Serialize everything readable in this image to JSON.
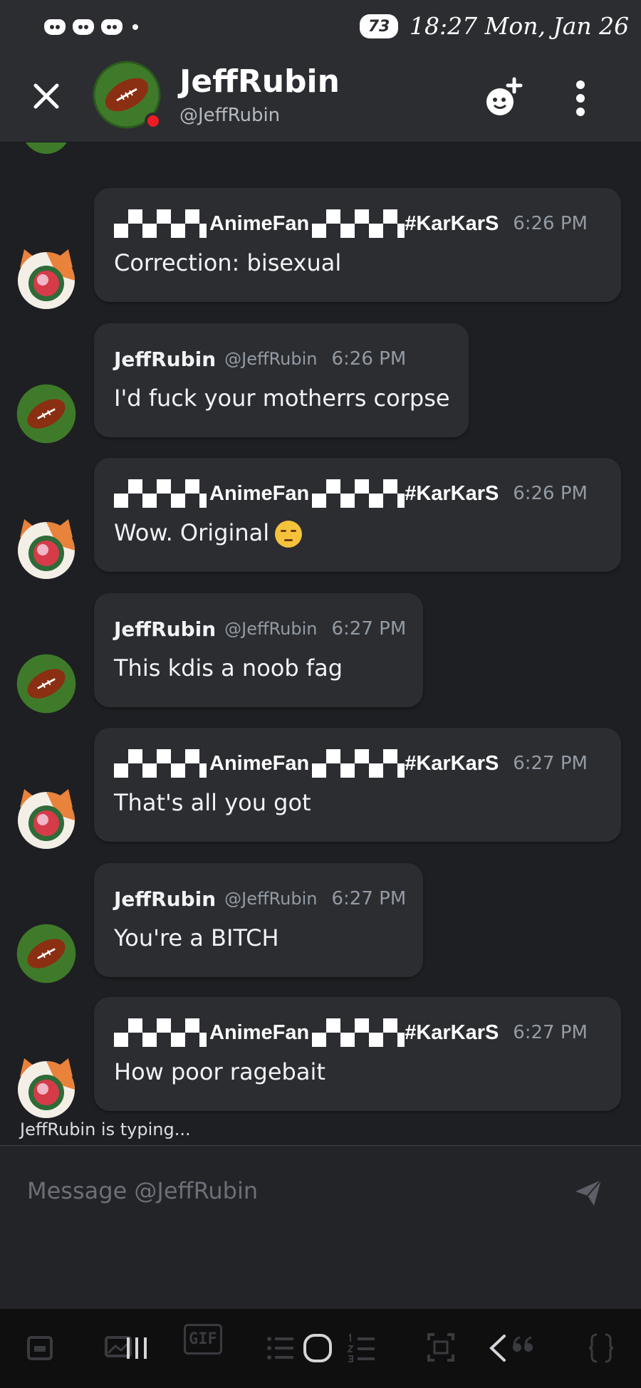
{
  "status_bar": {
    "battery": "73",
    "time_date": "18:27 Mon, Jan 26"
  },
  "header": {
    "name": "JeffRubin",
    "handle": "@JeffRubin",
    "presence_color": "#ed1c24"
  },
  "messages": [
    {
      "kind": "other",
      "display_name": "AnimeFan",
      "tag": "#KarKarS",
      "time": "6:26 PM",
      "text": "Correction: bisexual"
    },
    {
      "kind": "self",
      "author": "JeffRubin",
      "handle": "@JeffRubin",
      "time": "6:26 PM",
      "text": "I'd fuck your motherrs corpse"
    },
    {
      "kind": "other",
      "display_name": "AnimeFan",
      "tag": "#KarKarS",
      "time": "6:26 PM",
      "text": "Wow. Original",
      "emoji": "unamused-face-emoji"
    },
    {
      "kind": "self",
      "author": "JeffRubin",
      "handle": "@JeffRubin",
      "time": "6:27 PM",
      "text": "This kdis a noob fag"
    },
    {
      "kind": "other",
      "display_name": "AnimeFan",
      "tag": "#KarKarS",
      "time": "6:27 PM",
      "text": "That's all you got"
    },
    {
      "kind": "self",
      "author": "JeffRubin",
      "handle": "@JeffRubin",
      "time": "6:27 PM",
      "text": "You're a BITCH"
    },
    {
      "kind": "other",
      "display_name": "AnimeFan",
      "tag": "#KarKarS",
      "time": "6:27 PM",
      "text": "How poor ragebait"
    }
  ],
  "typing_indicator": "JeffRubin is typing...",
  "composer": {
    "placeholder": "Message @JeffRubin"
  },
  "toolbar": {
    "gif_label": "GIF",
    "icons": [
      "sticker-icon",
      "image-icon",
      "recent-apps-icon",
      "gif-icon",
      "bulleted-list-icon",
      "home-icon",
      "numbered-list-icon",
      "screenshot-icon",
      "back-icon",
      "quote-icon",
      "code-braces-icon"
    ]
  },
  "colors": {
    "background": "#1e1f22",
    "bubble": "#2b2d31",
    "header": "#2b2d31",
    "muted_text": "#949ba4"
  }
}
